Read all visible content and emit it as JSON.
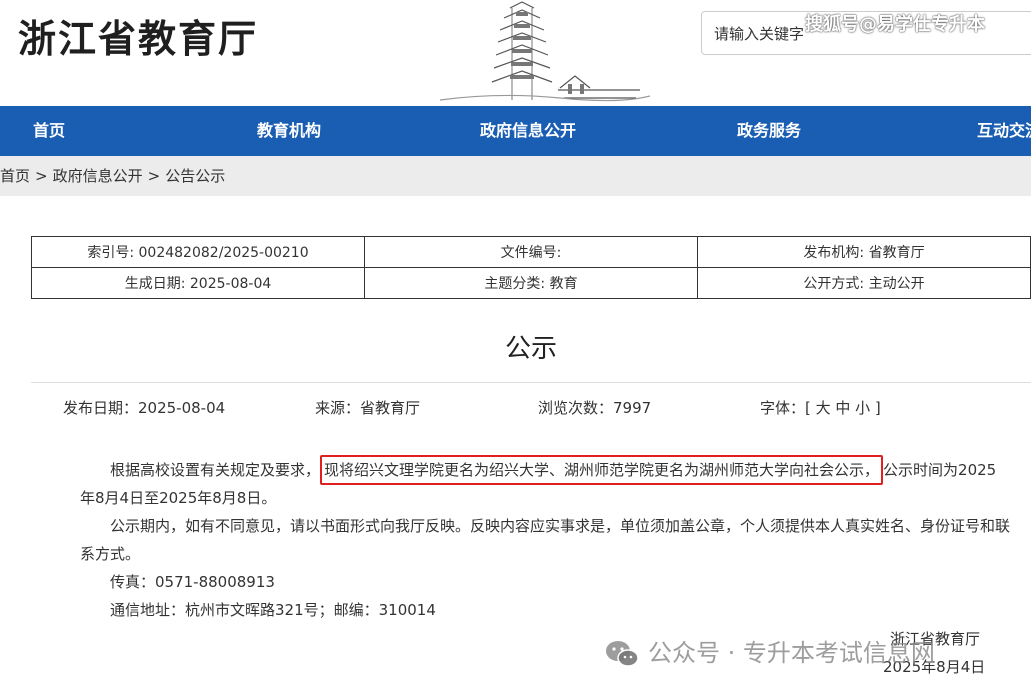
{
  "header": {
    "site_title": "浙江省教育厅",
    "search_placeholder": "请输入关键字",
    "watermark": "搜狐号@易学仕专升本"
  },
  "nav": {
    "items": [
      "首页",
      "教育机构",
      "政府信息公开",
      "政务服务",
      "互动交流"
    ]
  },
  "breadcrumb": [
    "首页",
    "政府信息公开",
    "公告公示"
  ],
  "meta_table": {
    "index_no": "索引号: 002482082/2025-00210",
    "doc_no": "文件编号:",
    "publisher": "发布机构: 省教育厅",
    "created": "生成日期: 2025-08-04",
    "category": "主题分类: 教育",
    "open_mode": "公开方式: 主动公开"
  },
  "article": {
    "title": "公示",
    "publish_date": "发布日期：2025-08-04",
    "source": "来源：省教育厅",
    "views": "浏览次数：7997",
    "font_size_label": "字体：[ 大 中 小 ]",
    "p1_prefix": "根据高校设置有关规定及要求，",
    "p1_highlight": "现将绍兴文理学院更名为绍兴大学、湖州师范学院更名为湖州师范大学向社会公示，",
    "p1_suffix": "公示时间为2025年8月4日至2025年8月8日。",
    "p2": "公示期内，如有不同意见，请以书面形式向我厅反映。反映内容应实事求是，单位须加盖公章，个人须提供本人真实姓名、身份证号和联系方式。",
    "fax": "传真：0571-88008913",
    "address": "通信地址：杭州市文晖路321号；邮编：310014",
    "sign_org": "浙江省教育厅",
    "sign_date": "2025年8月4日"
  },
  "watermark_bottom": "公众号 · 专升本考试信息网"
}
